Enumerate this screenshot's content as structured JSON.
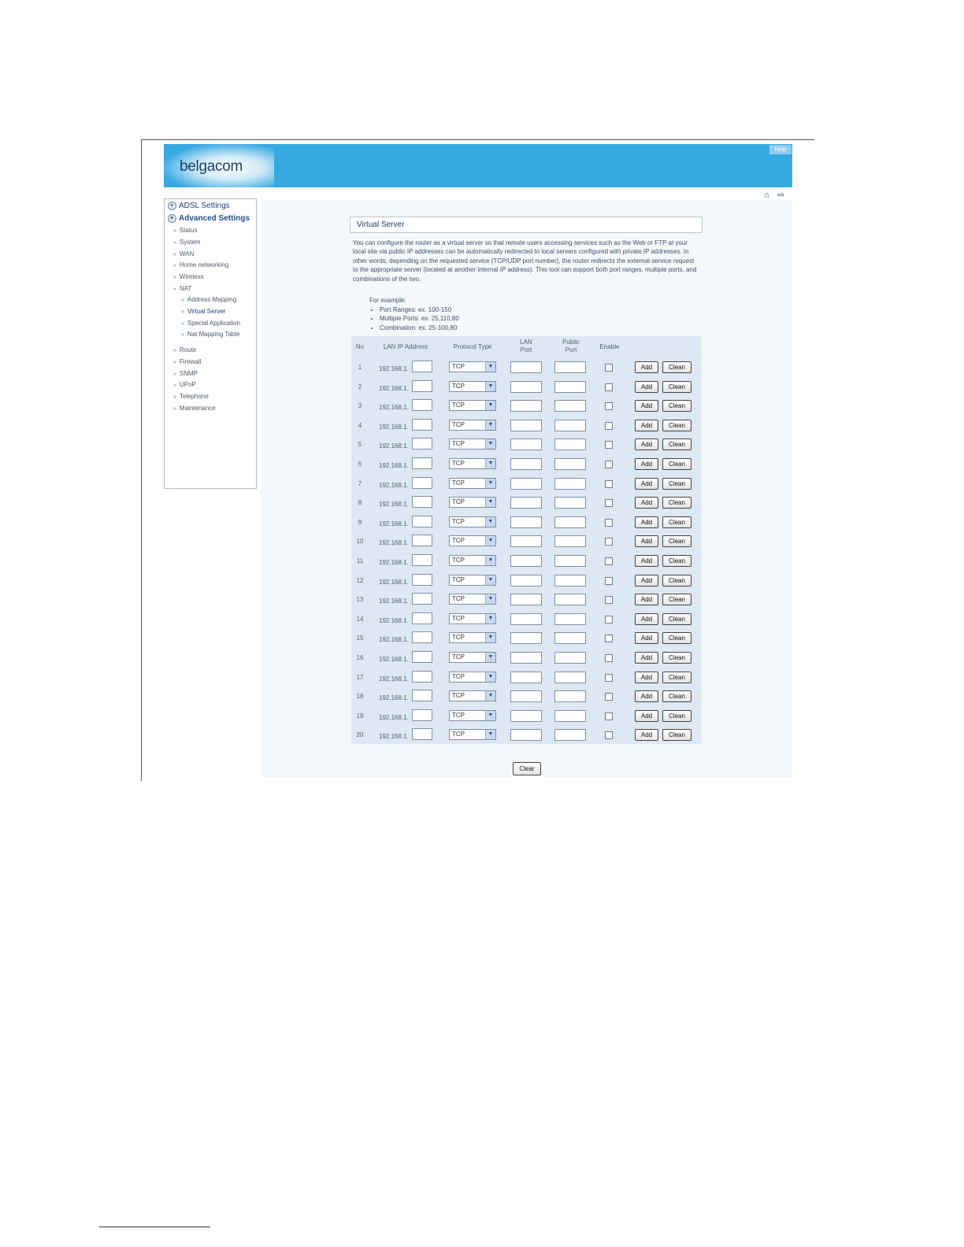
{
  "header": {
    "logo": "belgacom",
    "help_label": "help"
  },
  "icons": {
    "home": "home-icon",
    "logout": "logout-icon"
  },
  "sidebar": {
    "main_items": [
      {
        "label": "ADSL Settings"
      },
      {
        "label": "Advanced Settings"
      }
    ],
    "sub_items": [
      {
        "label": "Status"
      },
      {
        "label": "System"
      },
      {
        "label": "WAN"
      },
      {
        "label": "Home networking"
      },
      {
        "label": "Wireless"
      },
      {
        "label": "NAT"
      }
    ],
    "nat_items": [
      {
        "label": "Address Mapping"
      },
      {
        "label": "Virtual Server"
      },
      {
        "label": "Special Application"
      },
      {
        "label": "Nat Mapping Table"
      }
    ],
    "more_items": [
      {
        "label": "Route"
      },
      {
        "label": "Firewall"
      },
      {
        "label": "SNMP"
      },
      {
        "label": "UPnP"
      },
      {
        "label": "Telephone"
      },
      {
        "label": "Maintenance"
      }
    ]
  },
  "main": {
    "title": "Virtual Server",
    "description": "You can configure the router as a virtual server so that remote users accessing services such as the Web or FTP at your local site via public IP addresses can be automatically redirected to local servers configured with private IP addresses. In other words, depending on the requested service (TCP/UDP port number), the router redirects the external service request to the appropriate server (located at another internal IP address). This tool can support both port ranges, multiple ports, and combinations of the two.",
    "example_heading": "For example:",
    "examples": [
      "Port Ranges: ex. 100-150",
      "Multiple Ports: ex. 25,110,80",
      "Combination: ex. 25-100,80"
    ]
  },
  "table": {
    "headers": {
      "no": "No",
      "lan_ip": "LAN IP Address",
      "protocol": "Protocol Type",
      "lan_port_1": "LAN",
      "lan_port_2": "Port",
      "public_port_1": "Public",
      "public_port_2": "Port",
      "enable": "Enable"
    },
    "ip_prefix": "192.168.1.",
    "protocol_value": "TCP",
    "add_label": "Add",
    "clean_label": "Clean",
    "rows": [
      "1",
      "2",
      "3",
      "4",
      "5",
      "6",
      "7",
      "8",
      "9",
      "10",
      "11",
      "12",
      "13",
      "14",
      "15",
      "16",
      "17",
      "18",
      "19",
      "20"
    ]
  },
  "clear_label": "Clear"
}
